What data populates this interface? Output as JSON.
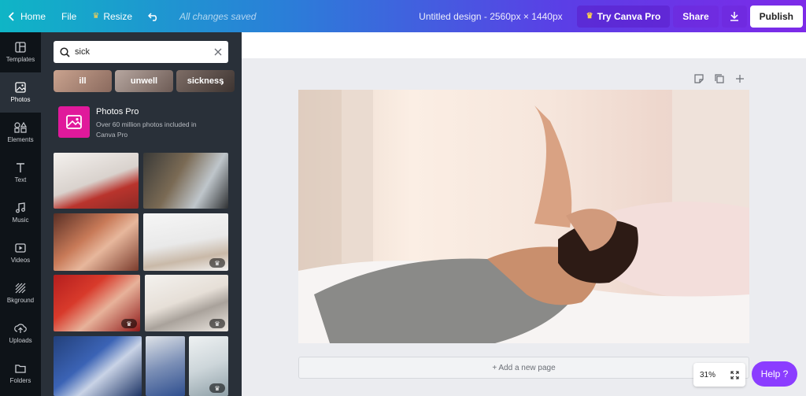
{
  "topbar": {
    "home_label": "Home",
    "file_label": "File",
    "resize_label": "Resize",
    "saved_status": "All changes saved",
    "design_title": "Untitled design - 2560px × 1440px",
    "try_pro_label": "Try Canva Pro",
    "share_label": "Share",
    "publish_label": "Publish"
  },
  "rail": {
    "items": [
      {
        "label": "Templates",
        "icon": "templates-icon"
      },
      {
        "label": "Photos",
        "icon": "photos-icon"
      },
      {
        "label": "Elements",
        "icon": "elements-icon"
      },
      {
        "label": "Text",
        "icon": "text-icon"
      },
      {
        "label": "Music",
        "icon": "music-icon"
      },
      {
        "label": "Videos",
        "icon": "videos-icon"
      },
      {
        "label": "Bkground",
        "icon": "background-icon"
      },
      {
        "label": "Uploads",
        "icon": "uploads-icon"
      },
      {
        "label": "Folders",
        "icon": "folders-icon"
      }
    ],
    "active": "Photos"
  },
  "panel": {
    "search_value": "sick",
    "chips": [
      "ill",
      "unwell",
      "sickness"
    ],
    "promo_title": "Photos Pro",
    "promo_subtitle": "Over 60 million photos included in Canva Pro"
  },
  "canvas": {
    "add_page_label": "+ Add a new page",
    "zoom_level": "31%"
  },
  "help_label": "Help ?",
  "colors": {
    "accent": "#8b3dff",
    "promo": "#e0199b",
    "panel": "#293039",
    "rail": "#0e1318"
  }
}
